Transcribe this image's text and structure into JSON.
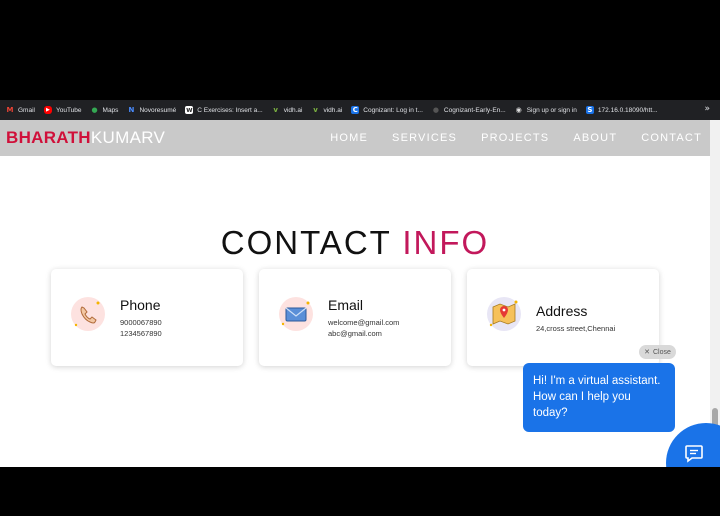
{
  "bookmarks": [
    {
      "label": "Gmail",
      "icon": "gmail-icon",
      "color": "#ea4335",
      "glyph": "M"
    },
    {
      "label": "YouTube",
      "icon": "youtube-icon",
      "color": "#ff0000",
      "glyph": "▶"
    },
    {
      "label": "Maps",
      "icon": "maps-icon",
      "color": "#34a853",
      "glyph": "●"
    },
    {
      "label": "Novoresumé",
      "icon": "novoresume-icon",
      "color": "#4a8cff",
      "glyph": "N"
    },
    {
      "label": "C Exercises: Insert a...",
      "icon": "w3resource-icon",
      "color": "#ffffff",
      "glyph": "w"
    },
    {
      "label": "vidh.ai",
      "icon": "vidh-icon",
      "color": "#7cb342",
      "glyph": "v"
    },
    {
      "label": "vidh.ai",
      "icon": "vidh-icon",
      "color": "#7cb342",
      "glyph": "v"
    },
    {
      "label": "Cognizant: Log in t...",
      "icon": "cognizant-icon",
      "color": "#1a73e8",
      "glyph": "C"
    },
    {
      "label": "Cognizant-Early-En...",
      "icon": "github-icon",
      "color": "#333333",
      "glyph": "●"
    },
    {
      "label": "Sign up or sign in",
      "icon": "globe-icon",
      "color": "#dddddd",
      "glyph": "◉"
    },
    {
      "label": "172.16.0.18090/htt...",
      "icon": "site-icon",
      "color": "#1a73e8",
      "glyph": "S"
    }
  ],
  "bookmarks_more": "»",
  "header": {
    "logo_first": "BHARATH",
    "logo_second": "KUMARV",
    "logo_first_color": "#d0103a",
    "nav": [
      "HOME",
      "SERVICES",
      "PROJECTS",
      "ABOUT",
      "CONTACT"
    ]
  },
  "contact": {
    "heading_a": "CONTACT ",
    "heading_b": "INFO",
    "accent_color": "#c2185b",
    "cards": [
      {
        "title": "Phone",
        "icon": "phone-icon",
        "lines": [
          "9000067890",
          "1234567890"
        ]
      },
      {
        "title": "Email",
        "icon": "envelope-icon",
        "lines": [
          "welcome@gmail.com",
          "abc@gmail.com"
        ]
      },
      {
        "title": "Address",
        "icon": "map-pin-icon",
        "lines": [
          "24,cross street,Chennai"
        ]
      }
    ]
  },
  "chat": {
    "close_label": "Close",
    "close_glyph": "✕",
    "message": "Hi! I'm a virtual assistant. How can I help you today?",
    "button_color": "#1a73e8"
  }
}
